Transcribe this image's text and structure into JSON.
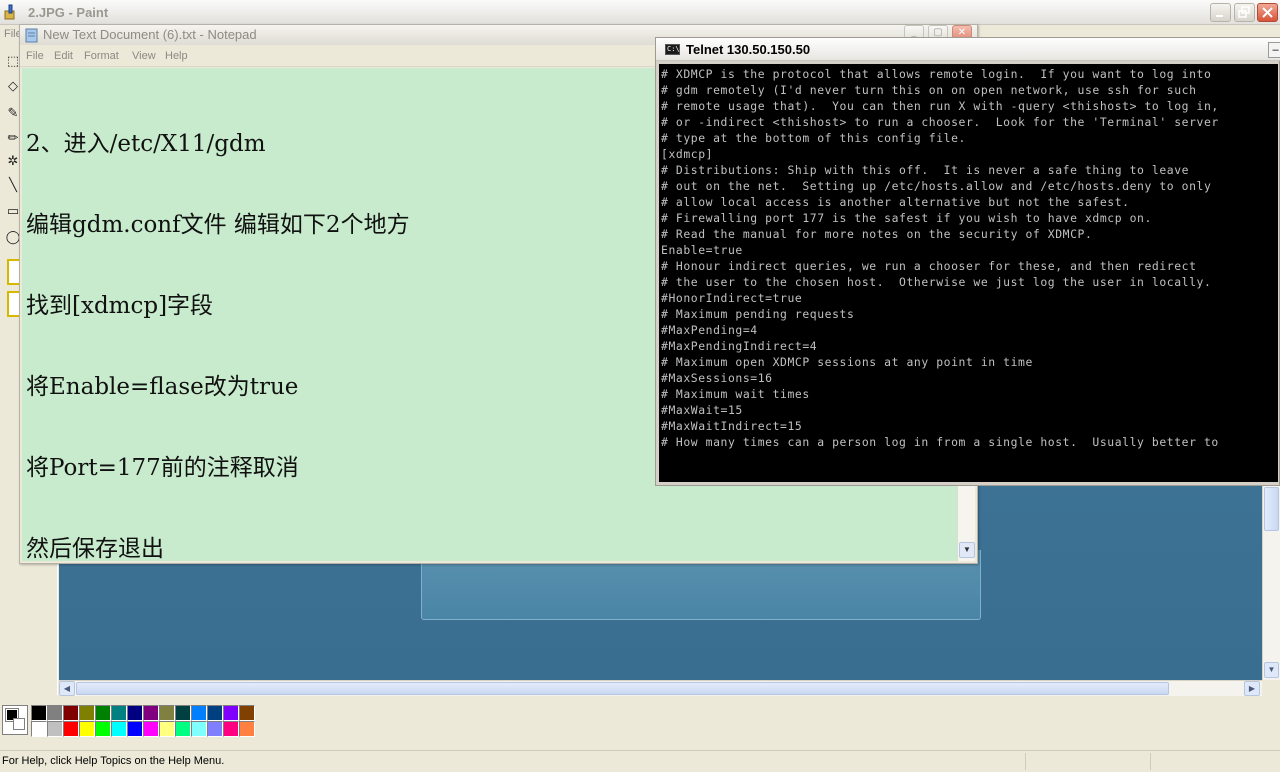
{
  "paint": {
    "title": "2.JPG - Paint",
    "menu_file": "File",
    "status": "For Help, click Help Topics on the Help Menu.",
    "palette": {
      "foreground": "#000000",
      "background": "#ffffff",
      "colors": [
        "#000000",
        "#808080",
        "#800000",
        "#808000",
        "#008000",
        "#008080",
        "#000080",
        "#800080",
        "#808040",
        "#004040",
        "#0080ff",
        "#004080",
        "#8000ff",
        "#804000",
        "#ffffff",
        "#c0c0c0",
        "#ff0000",
        "#ffff00",
        "#00ff00",
        "#00ffff",
        "#0000ff",
        "#ff00ff",
        "#ffff80",
        "#00ff80",
        "#80ffff",
        "#8080ff",
        "#ff0080",
        "#ff8040"
      ]
    }
  },
  "notepad": {
    "title": "New Text Document (6).txt - Notepad",
    "menu": [
      "File",
      "Edit",
      "Format",
      "View",
      "Help"
    ],
    "lines": [
      "2、进入/etc/X11/gdm",
      "编辑gdm.conf文件 编辑如下2个地方",
      "找到[xdmcp]字段",
      "将Enable=flase改为true",
      "将Port=177前的注释取消",
      "然后保存退出"
    ]
  },
  "telnet": {
    "title": "Telnet 130.50.150.50",
    "lines": [
      "# XDMCP is the protocol that allows remote login.  If you want to log into",
      "# gdm remotely (I'd never turn this on on open network, use ssh for such",
      "# remote usage that).  You can then run X with -query <thishost> to log in,",
      "# or -indirect <thishost> to run a chooser.  Look for the 'Terminal' server",
      "# type at the bottom of this config file.",
      "[xdmcp]",
      "# Distributions: Ship with this off.  It is never a safe thing to leave",
      "# out on the net.  Setting up /etc/hosts.allow and /etc/hosts.deny to only",
      "# allow local access is another alternative but not the safest.",
      "# Firewalling port 177 is the safest if you wish to have xdmcp on.",
      "# Read the manual for more notes on the security of XDMCP.",
      "Enable=true",
      "# Honour indirect queries, we run a chooser for these, and then redirect",
      "# the user to the chosen host.  Otherwise we just log the user in locally.",
      "#HonorIndirect=true",
      "# Maximum pending requests",
      "#MaxPending=4",
      "#MaxPendingIndirect=4",
      "# Maximum open XDMCP sessions at any point in time",
      "#MaxSessions=16",
      "# Maximum wait times",
      "#MaxWait=15",
      "#MaxWaitIndirect=15",
      "# How many times can a person log in from a single host.  Usually better to"
    ]
  }
}
